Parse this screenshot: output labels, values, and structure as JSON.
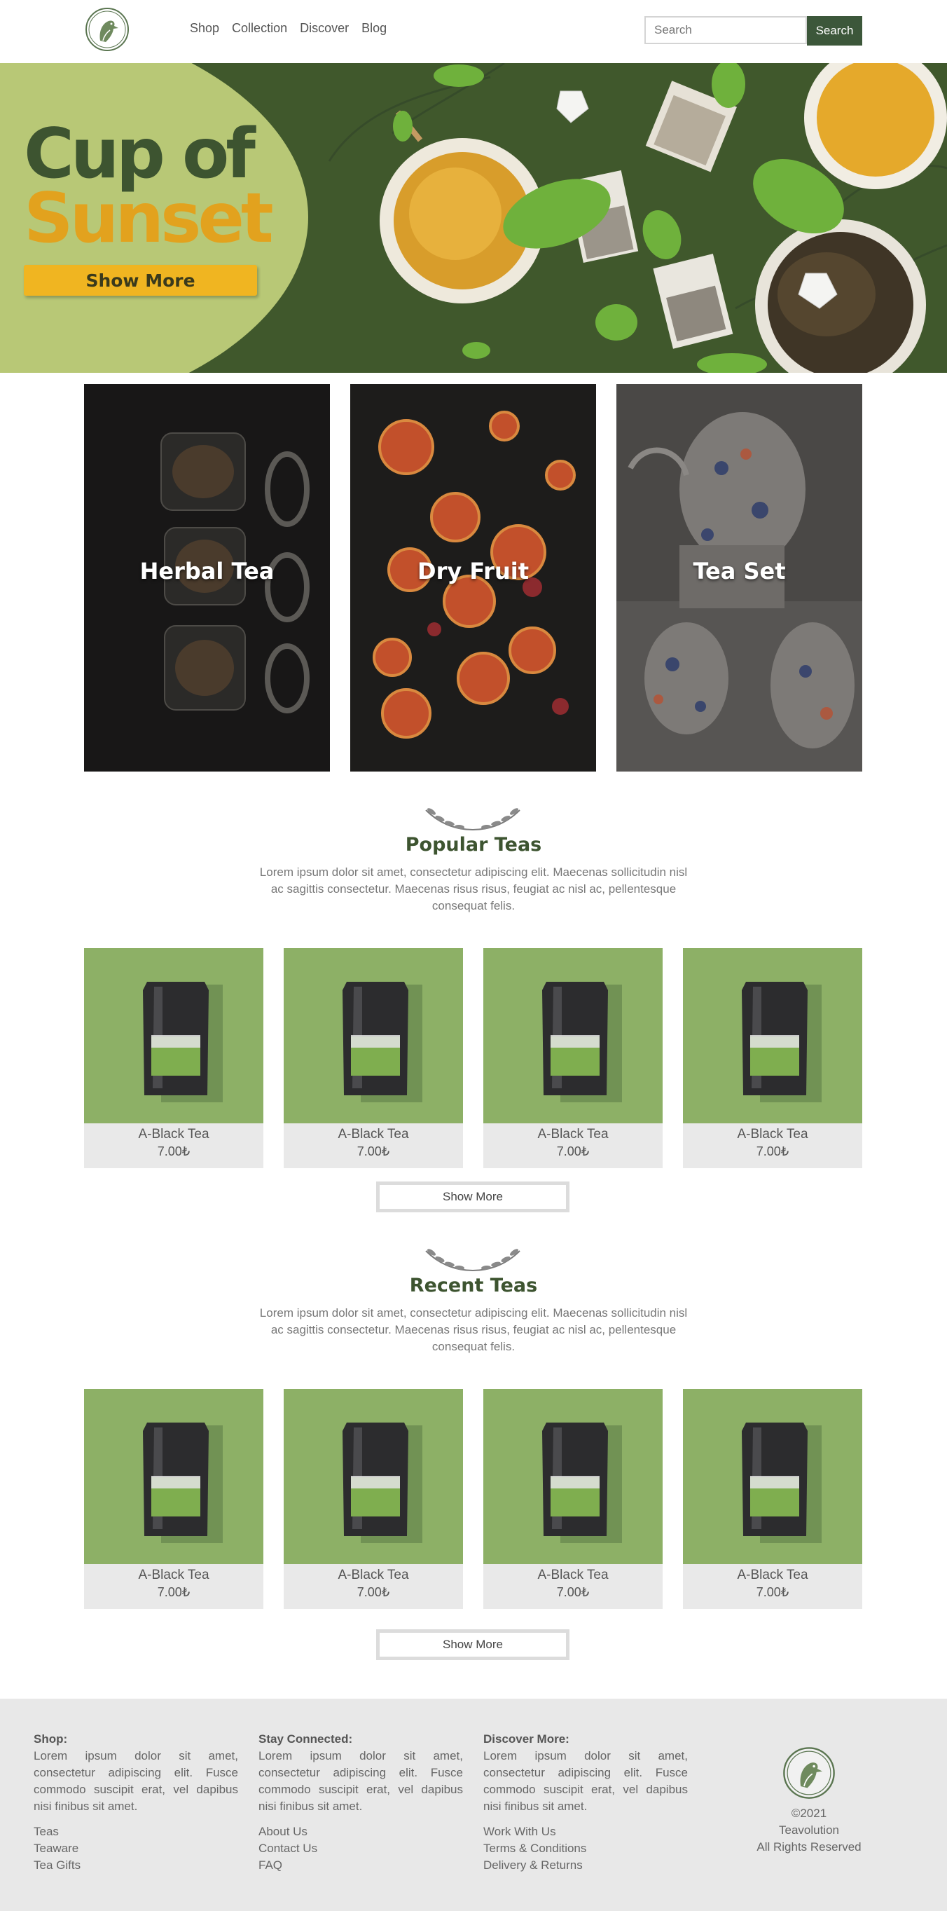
{
  "header": {
    "nav": [
      "Shop",
      "Collection",
      "Discover",
      "Blog"
    ],
    "search_placeholder": "Search",
    "search_button": "Search"
  },
  "hero": {
    "title_line1": "Cup of",
    "title_line2": "Sunset",
    "button": "Show More"
  },
  "categories": [
    {
      "label": "Herbal Tea"
    },
    {
      "label": "Dry Fruit"
    },
    {
      "label": "Tea Set"
    }
  ],
  "popular": {
    "title": "Popular Teas",
    "description": "Lorem ipsum dolor sit amet, consectetur adipiscing elit. Maecenas sollicitudin nisl ac sagittis consectetur. Maecenas risus risus, feugiat ac nisl ac, pellentesque consequat felis.",
    "products": [
      {
        "name": "A-Black Tea",
        "price": "7.00₺"
      },
      {
        "name": "A-Black Tea",
        "price": "7.00₺"
      },
      {
        "name": "A-Black Tea",
        "price": "7.00₺"
      },
      {
        "name": "A-Black Tea",
        "price": "7.00₺"
      }
    ],
    "button": "Show More"
  },
  "recent": {
    "title": "Recent Teas",
    "description": "Lorem ipsum dolor sit amet, consectetur adipiscing elit. Maecenas sollicitudin nisl ac sagittis consectetur. Maecenas risus risus, feugiat ac nisl ac, pellentesque consequat felis.",
    "products": [
      {
        "name": "A-Black Tea",
        "price": "7.00₺"
      },
      {
        "name": "A-Black Tea",
        "price": "7.00₺"
      },
      {
        "name": "A-Black Tea",
        "price": "7.00₺"
      },
      {
        "name": "A-Black Tea",
        "price": "7.00₺"
      }
    ],
    "button": "Show More"
  },
  "footer": {
    "columns": [
      {
        "title": "Shop:",
        "text": "Lorem ipsum dolor sit amet, consectetur adipiscing elit. Fusce commodo suscipit erat, vel dapibus nisi finibus sit amet.",
        "links": [
          "Teas",
          "Teaware",
          "Tea Gifts"
        ]
      },
      {
        "title": "Stay Connected:",
        "text": "Lorem ipsum dolor sit amet, consectetur adipiscing elit. Fusce commodo suscipit erat, vel dapibus nisi finibus sit amet.",
        "links": [
          "About Us",
          "Contact Us",
          "FAQ"
        ]
      },
      {
        "title": "Discover More:",
        "text": "Lorem ipsum dolor sit amet, consectetur adipiscing elit. Fusce commodo suscipit erat, vel dapibus nisi finibus sit amet.",
        "links": [
          "Work With Us",
          "Terms & Conditions",
          "Delivery & Returns"
        ]
      }
    ],
    "copyright": "©2021",
    "brand": "Teavolution",
    "rights": "All Rights Reserved"
  },
  "colors": {
    "brand_green": "#3c573a",
    "hero_bg": "#40582c",
    "hero_arc": "#b8c876",
    "accent_yellow": "#f0b521",
    "product_bg": "#8db066",
    "footer_bg": "#e8e8e8"
  },
  "icons": [
    "bird-logo-icon",
    "laurel-icon"
  ]
}
